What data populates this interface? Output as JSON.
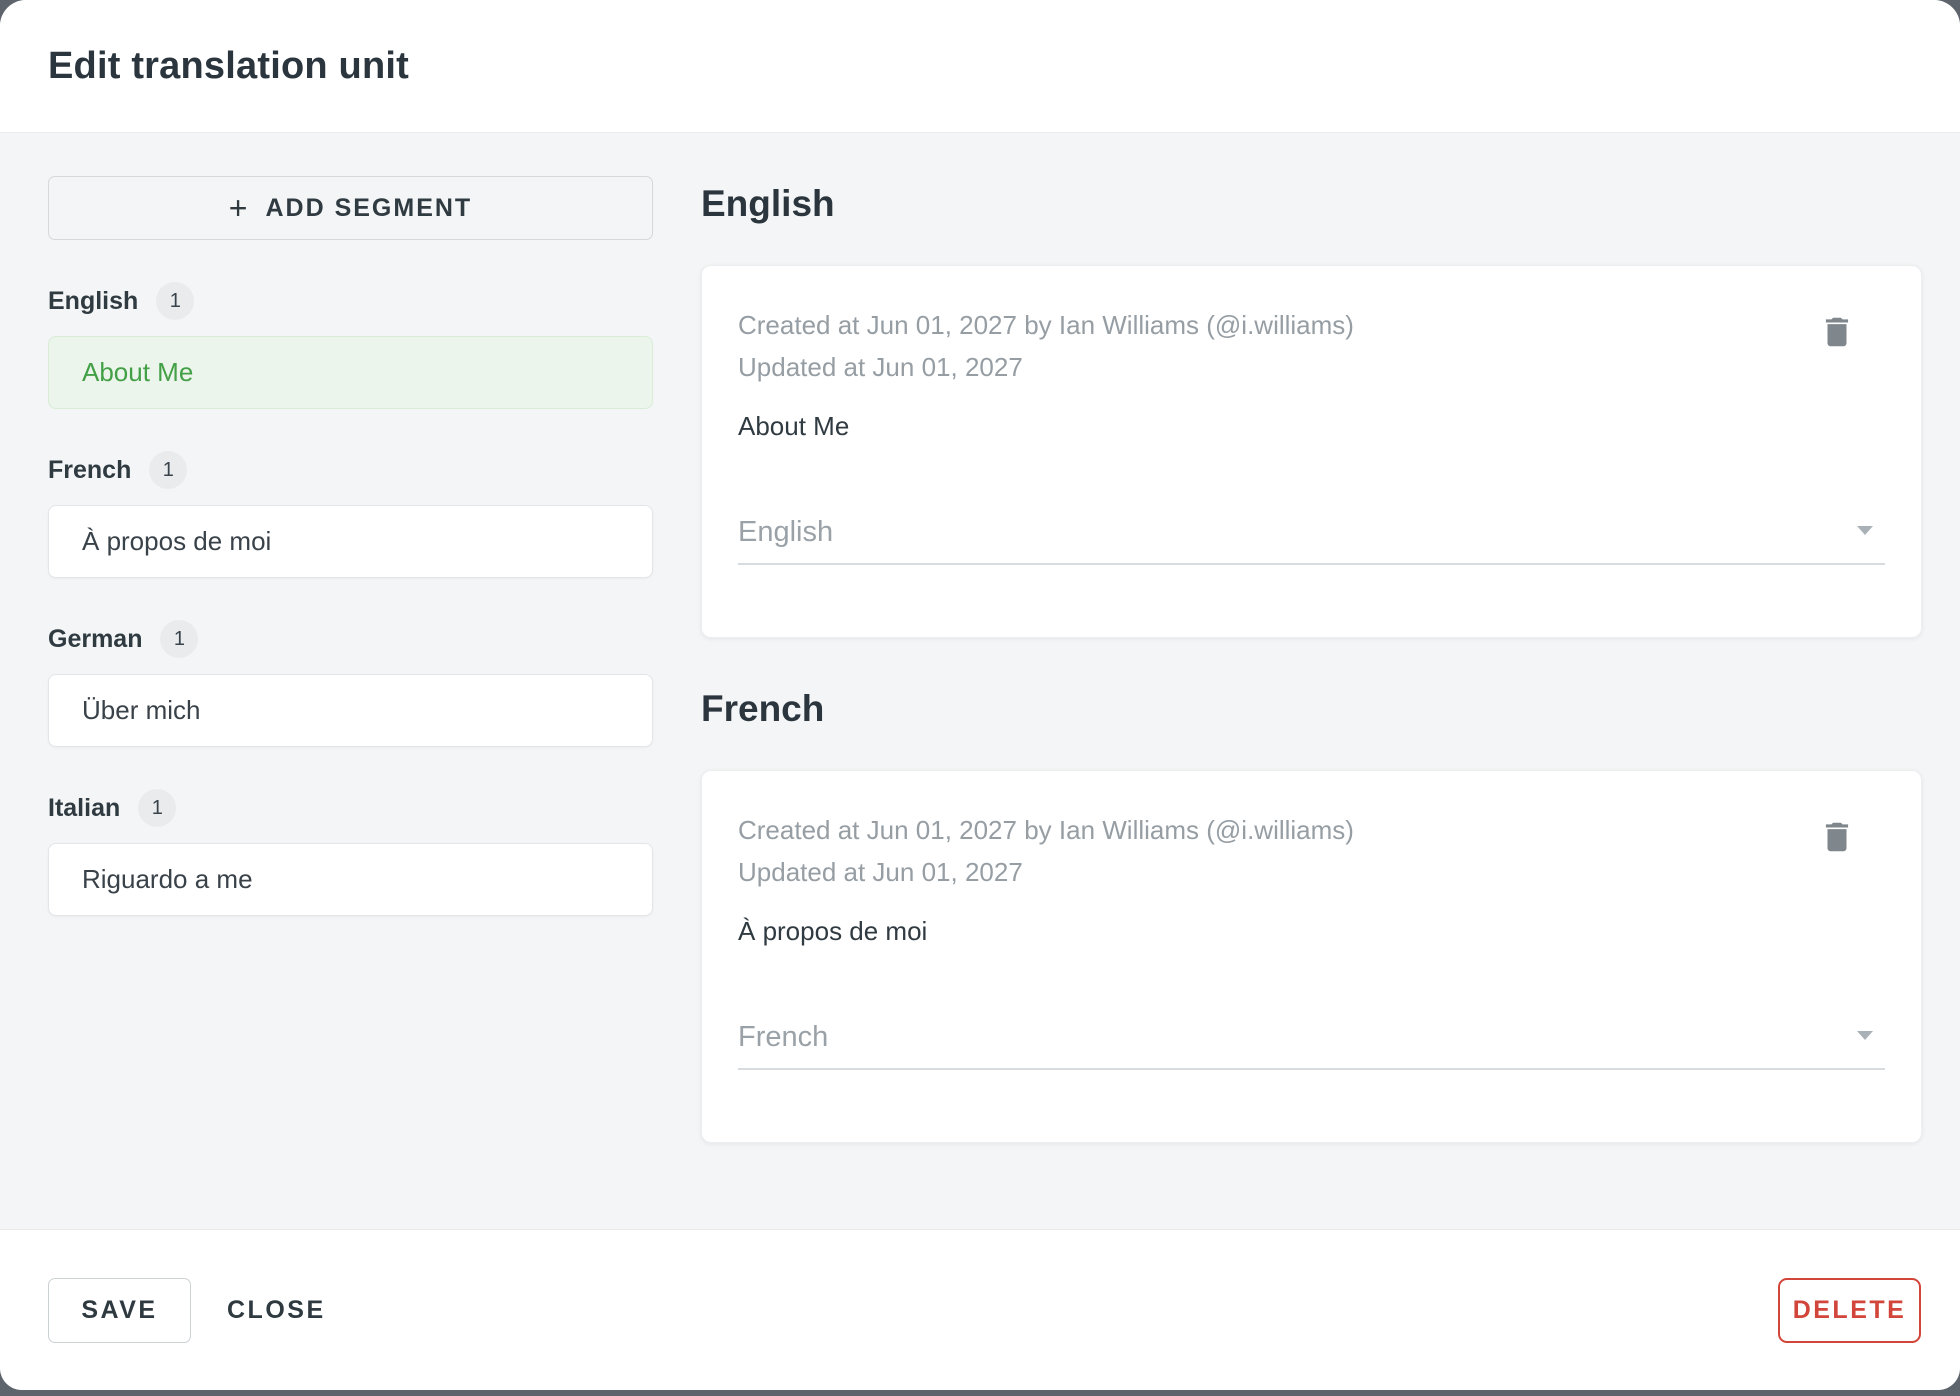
{
  "dialog": {
    "title": "Edit translation unit"
  },
  "sidebar": {
    "add_segment": {
      "plus": "+",
      "label": "ADD SEGMENT"
    },
    "groups": [
      {
        "language": "English",
        "count": "1",
        "segments": [
          {
            "text": "About Me",
            "selected": true
          }
        ]
      },
      {
        "language": "French",
        "count": "1",
        "segments": [
          {
            "text": "À propos de moi",
            "selected": false
          }
        ]
      },
      {
        "language": "German",
        "count": "1",
        "segments": [
          {
            "text": "Über mich",
            "selected": false
          }
        ]
      },
      {
        "language": "Italian",
        "count": "1",
        "segments": [
          {
            "text": "Riguardo a me",
            "selected": false
          }
        ]
      }
    ]
  },
  "main": {
    "sections": [
      {
        "heading": "English",
        "created_line": "Created at Jun 01, 2027 by Ian Williams (@i.williams)",
        "updated_line": "Updated at Jun 01, 2027",
        "content": "About Me",
        "language_select_value": "English"
      },
      {
        "heading": "French",
        "created_line": "Created at Jun 01, 2027 by Ian Williams (@i.williams)",
        "updated_line": "Updated at Jun 01, 2027",
        "content": "À propos de moi",
        "language_select_value": "French"
      }
    ]
  },
  "footer": {
    "save_label": "SAVE",
    "close_label": "CLOSE",
    "delete_label": "DELETE"
  },
  "colors": {
    "accent_green_text": "#43a047",
    "accent_green_bg": "#ecf5eb",
    "danger_red": "#d1453a",
    "body_background": "#f3f5f6",
    "meta_gray": "#969ea4"
  }
}
